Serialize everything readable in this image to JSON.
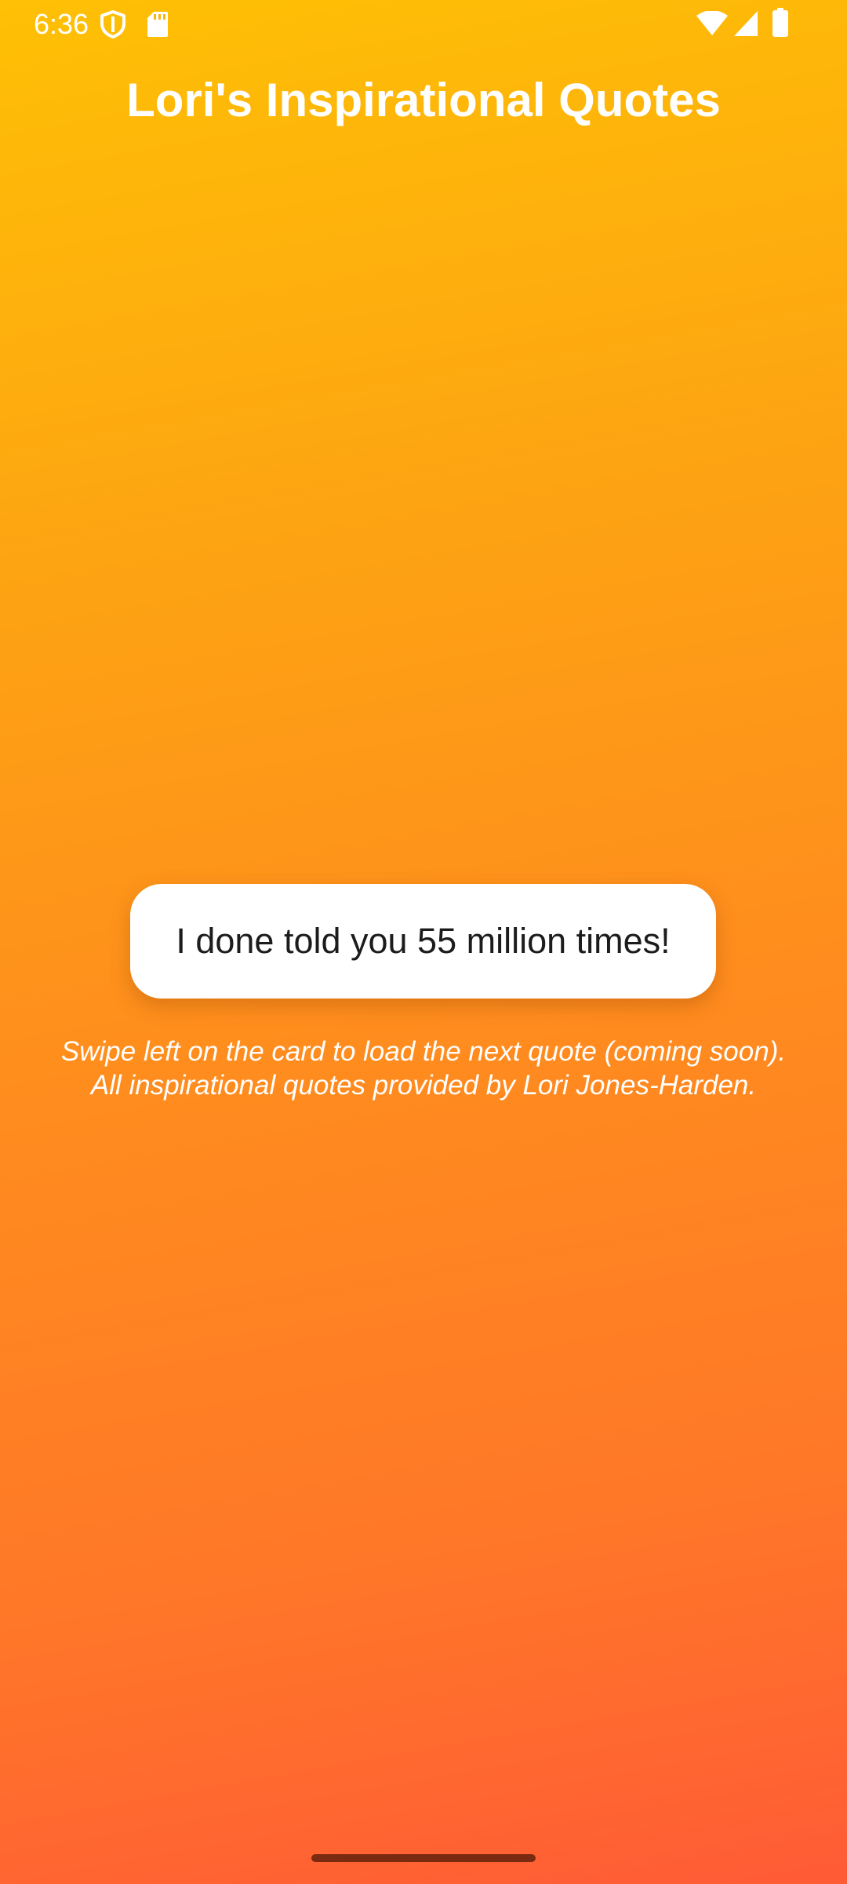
{
  "status_bar": {
    "time": "6:36",
    "left_icons": [
      "shield-icon",
      "sd-card-icon"
    ],
    "right_icons": [
      "wifi-icon",
      "cellular-signal-icon",
      "battery-icon"
    ]
  },
  "app": {
    "title": "Lori's Inspirational Quotes"
  },
  "quote_card": {
    "text": "I done told you 55 million times!"
  },
  "instructions": {
    "line1": "Swipe left on the card to load the next quote (coming soon).",
    "line2": "All inspirational quotes provided by Lori Jones-Harden."
  },
  "colors": {
    "gradient_top": "#FFC005",
    "gradient_bottom": "#FF5B36",
    "card_background": "#FFFFFF",
    "text_light": "#FFFFFF",
    "text_dark": "#1C1C1C"
  }
}
